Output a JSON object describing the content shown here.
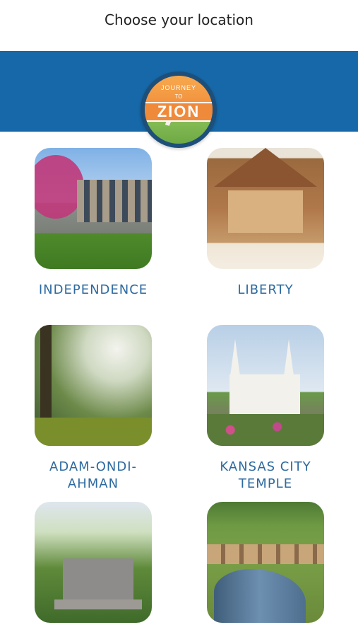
{
  "header": {
    "title": "Choose your location"
  },
  "logo": {
    "top_text": "JOURNEY",
    "middle_text": "TO",
    "main_text": "ZION"
  },
  "locations": [
    {
      "label": "INDEPENDENCE",
      "photo": "independence-photo"
    },
    {
      "label": "LIBERTY",
      "photo": "liberty-photo"
    },
    {
      "label": "ADAM-ONDI-AHMAN",
      "photo": "adam-ondi-ahman-photo"
    },
    {
      "label": "KANSAS CITY TEMPLE",
      "photo": "kansas-city-temple-photo"
    },
    {
      "label": "",
      "photo": "monument-photo"
    },
    {
      "label": "",
      "photo": "creek-photo"
    }
  ],
  "colors": {
    "banner": "#1668a8",
    "label": "#2c6aa0",
    "logo_ring": "#1d4f7a",
    "logo_orange": "#f08a3b"
  }
}
